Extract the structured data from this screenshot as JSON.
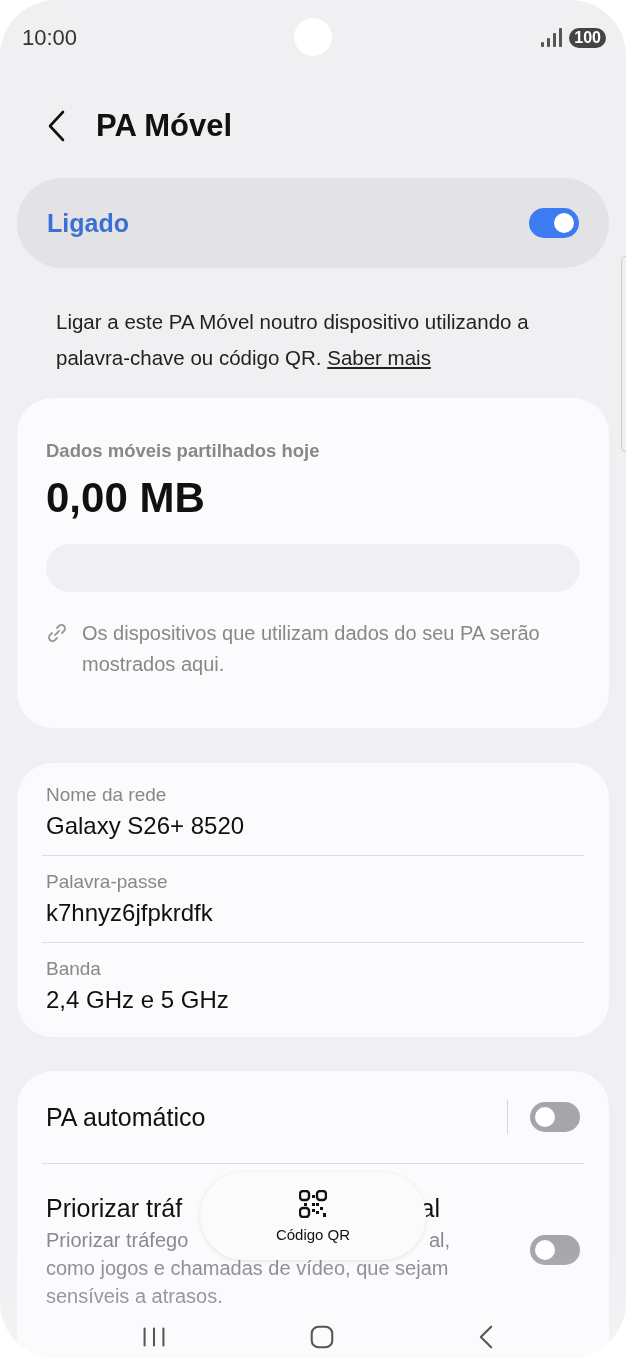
{
  "status_bar": {
    "time": "10:00",
    "battery": "100"
  },
  "header": {
    "title": "PA Móvel"
  },
  "master_switch": {
    "label": "Ligado",
    "on": true
  },
  "intro": {
    "text": "Ligar a este PA Móvel noutro dispositivo utilizando a palavra-chave ou código QR.",
    "link": "Saber mais"
  },
  "usage_card": {
    "title": "Dados móveis partilhados hoje",
    "amount": "0,00 MB",
    "note": "Os dispositivos que utilizam dados do seu PA serão mostrados aqui."
  },
  "network": [
    {
      "label": "Nome da rede",
      "value": "Galaxy S26+ 8520"
    },
    {
      "label": "Palavra-passe",
      "value": "k7hnyz6jfpkrdfk"
    },
    {
      "label": "Banda",
      "value": "2,4 GHz e 5 GHz"
    }
  ],
  "toggles": [
    {
      "title_parts": [
        "PA automático"
      ],
      "on": false
    },
    {
      "title_parts": [
        "Priorizar tráf",
        "al"
      ],
      "description_lines": [
        [
          "Priorizar tráfego",
          "al,"
        ],
        [
          "como jogos e chamadas de vídeo, que sejam"
        ],
        [
          "sensíveis a atrasos."
        ]
      ],
      "on": false
    }
  ],
  "floating_button": {
    "label": "Código QR"
  }
}
